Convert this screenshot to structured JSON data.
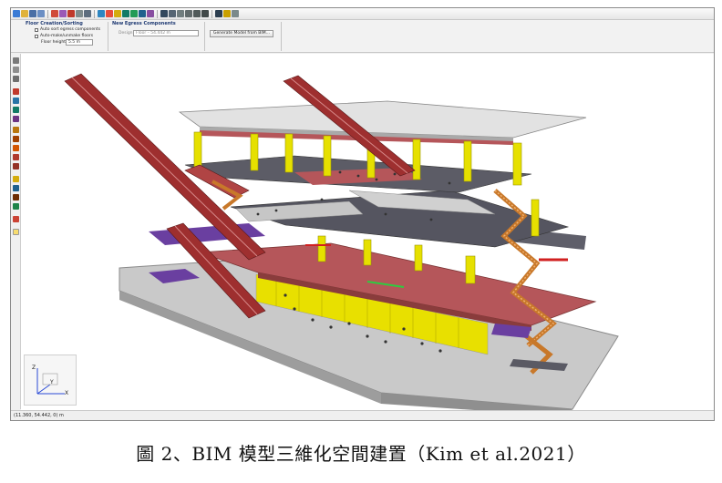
{
  "ribbon": {
    "floor_group_title": "Floor Creation/Sorting",
    "option_sort": "Auto sort egress components",
    "option_enclose": "Auto-make/unmake floors",
    "floor_height_label": "Floor height:",
    "floor_height_value": "5.5 m",
    "egress_group_title": "New Egress Components",
    "design_label": "Design:",
    "design_value": "Floor – 54.442 m",
    "compute_button": "Generate Model from BIM…"
  },
  "statusbar": {
    "coords": "(11.360, 54.442, 0) m"
  },
  "axis": {
    "z": "Z",
    "x": "X",
    "y": "Y"
  },
  "caption": "圖 2、BIM 模型三維化空間建置（Kim et al.2021）",
  "colors": {
    "slab_top": "#c9c9c9",
    "slab_edge": "#8f8f8f",
    "red_floor": "#b5565a",
    "column": "#e6e000",
    "escalator": "#9e2f2f",
    "stair": "#c8782a",
    "purple": "#6a3fa0"
  }
}
